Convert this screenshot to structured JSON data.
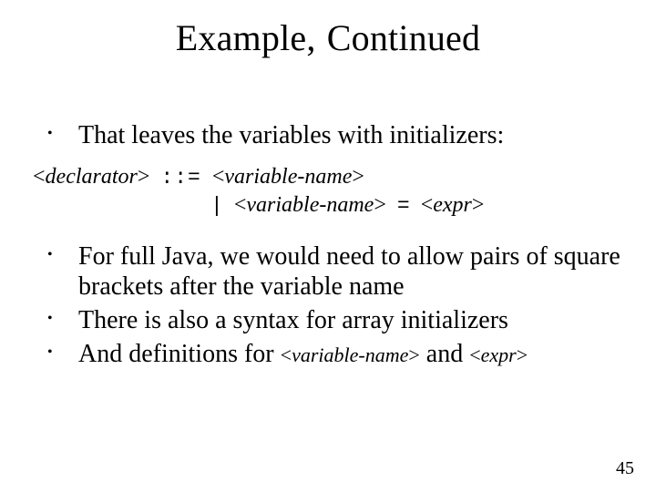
{
  "title_a": "Example",
  "title_comma": ",",
  "title_b": "Continued",
  "bullets_top": [
    "That leaves the variables with initializers:"
  ],
  "grammar": {
    "lhs": "declarator",
    "op": "::=",
    "rhs1": "variable-name",
    "pipe": "|",
    "rhs2_a": "variable-name",
    "eq": "=",
    "rhs2_b": "expr"
  },
  "bullets_bottom": [
    "For full Java, we would need to allow pairs of square brackets after the variable name",
    "There is also a syntax for array initializers"
  ],
  "last_bullet": {
    "pre": "And definitions for ",
    "nt1": "variable-name",
    "mid": " and ",
    "nt2": "expr"
  },
  "angle_open": "<",
  "angle_close": ">",
  "page_number": "45"
}
